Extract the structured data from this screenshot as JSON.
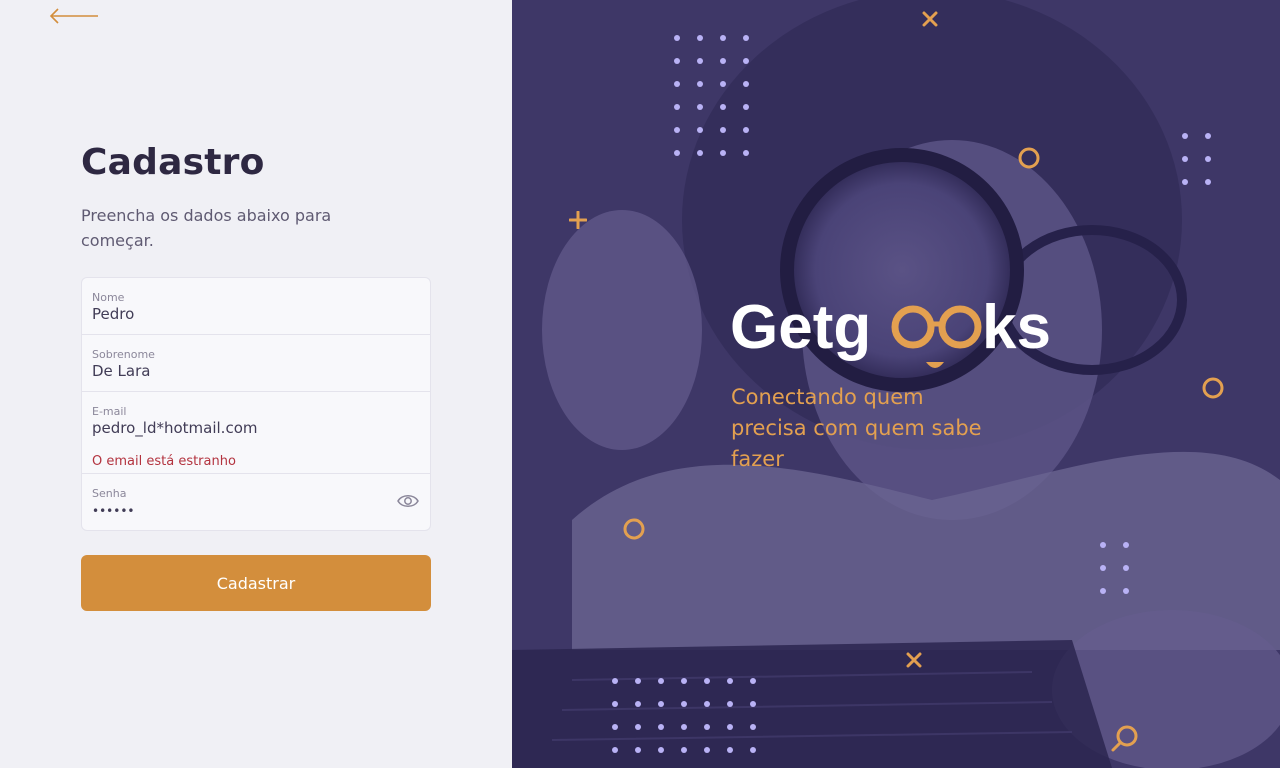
{
  "app": {
    "name": "Getgeeks"
  },
  "signup": {
    "title": "Cadastro",
    "subtitle": "Preencha os dados abaixo para começar.",
    "fields": [
      {
        "label": "Nome",
        "value": "Pedro"
      },
      {
        "label": "Sobrenome",
        "value": "De Lara"
      },
      {
        "label": "E-mail",
        "value": "pedro_ld*hotmail.com",
        "error": "O email está estranho"
      },
      {
        "label": "Senha",
        "value": "••••••"
      }
    ],
    "submit_label": "Cadastrar"
  },
  "hero": {
    "logo_text": "Getgeeks",
    "tagline": "Conectando quem precisa com quem sabe fazer"
  },
  "icons": {
    "back": "arrow-left-icon",
    "password_toggle": "eye-icon",
    "decor": [
      "plus-icon",
      "close-icon",
      "circle-icon",
      "magnifier-icon",
      "dot-grid"
    ]
  },
  "colors": {
    "accent": "#d38e3c",
    "brand_purple": "#3e3767",
    "title": "#2e2842",
    "error": "#b3333f",
    "panel_bg": "#f0f0f5"
  }
}
